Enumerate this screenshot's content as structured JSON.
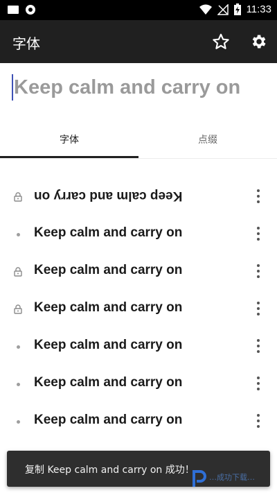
{
  "status_bar": {
    "time": "11:33",
    "icons": [
      "notification-icon",
      "location-icon",
      "wifi-icon",
      "no-signal-icon",
      "battery-charging-icon"
    ]
  },
  "app_bar": {
    "title": "字体",
    "actions": [
      {
        "icon": "star-outline-icon"
      },
      {
        "icon": "settings-gear-icon"
      }
    ]
  },
  "preview_input": {
    "placeholder": "Keep calm and carry on",
    "value": ""
  },
  "tabs": [
    {
      "label": "字体",
      "active": true
    },
    {
      "label": "点缀",
      "active": false
    }
  ],
  "font_list": [
    {
      "text": "Keep calm and carry on",
      "lead": "lock-icon",
      "style": "upside-down"
    },
    {
      "text": "Keep calm and carry on",
      "lead": "dot",
      "style": "bold"
    },
    {
      "text": "Keep calm and carry on",
      "lead": "lock-icon",
      "style": "bold"
    },
    {
      "text": "Keep calm and carry on",
      "lead": "lock-icon",
      "style": "bold"
    },
    {
      "text": "Keep calm and carry on",
      "lead": "dot",
      "style": "bold"
    },
    {
      "text": "Keep calm and carry on",
      "lead": "dot",
      "style": "bold"
    },
    {
      "text": "Keep calm and carry on",
      "lead": "dot",
      "style": "bold"
    }
  ],
  "toast": {
    "message": "复制 Keep calm and carry on 成功！"
  },
  "watermark": {
    "text": "…成功下载…"
  },
  "colors": {
    "status_bar": "#000000",
    "app_bar": "#202020",
    "tab_indicator": "#202020",
    "cursor": "#3f51b5",
    "toast": "#2e2e2e"
  }
}
